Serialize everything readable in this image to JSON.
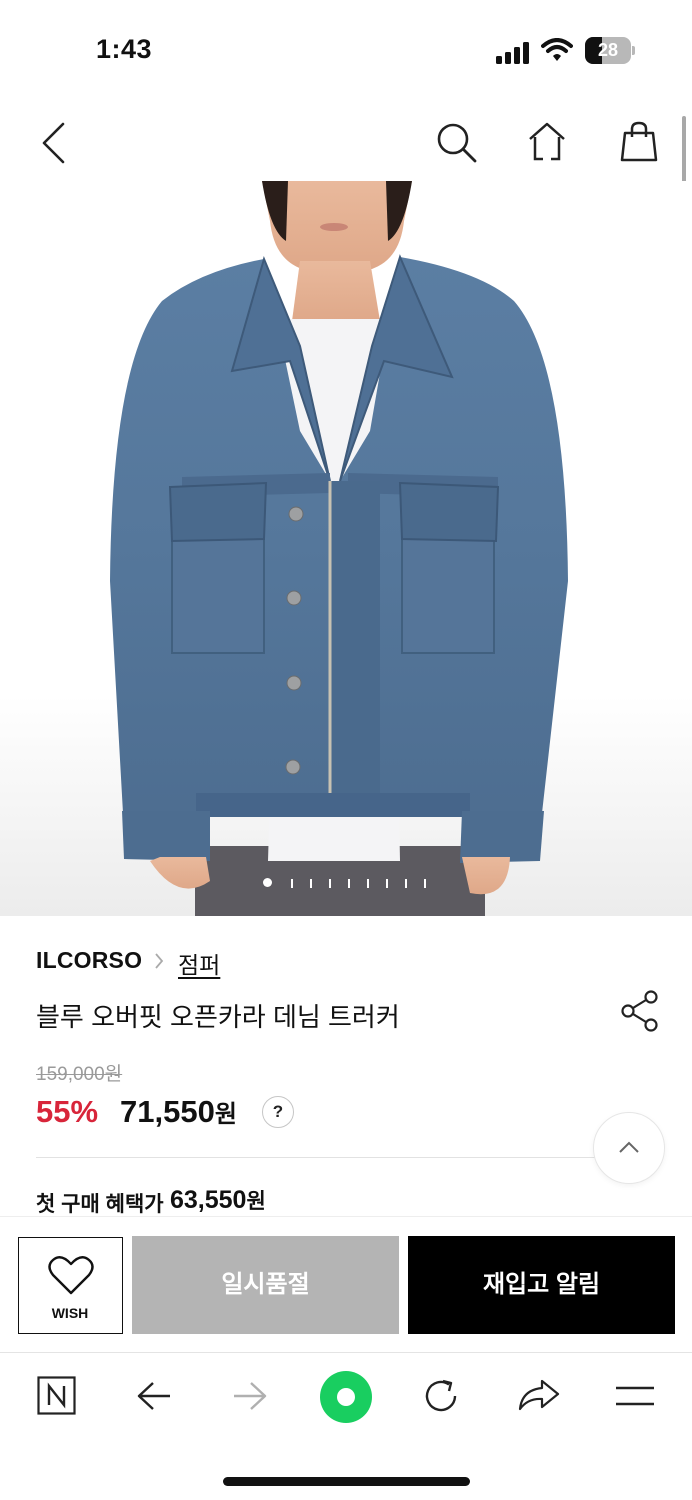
{
  "status_bar": {
    "time": "1:43",
    "battery": "28"
  },
  "header": {
    "back_icon": "chevron-left-icon",
    "search_icon": "search-icon",
    "home_icon": "home-icon",
    "bag_icon": "shopping-bag-icon"
  },
  "gallery": {
    "current_index": 1,
    "total": 9
  },
  "product": {
    "brand": "ILCORSO",
    "category": "점퍼",
    "title": "블루 오버핏 오픈카라 데님 트러커",
    "original_price": "159,000원",
    "discount": "55%",
    "sale_price": "71,550",
    "currency": "원",
    "help": "?",
    "benefit_label": "첫 구매 혜택가",
    "benefit_price": "63,550",
    "benefit_currency": "원"
  },
  "actions": {
    "wish_label": "WISH",
    "soldout_label": "일시품절",
    "restock_label": "재입고 알림"
  },
  "browser_toolbar": {
    "items": [
      "naver-n-icon",
      "back-arrow-icon",
      "forward-arrow-icon",
      "green-circle-icon",
      "refresh-icon",
      "share-arrow-icon",
      "menu-icon"
    ]
  },
  "colors": {
    "discount": "#d8253a",
    "soldout_bg": "#b4b4b4",
    "restock_bg": "#000000",
    "naver_green": "#19ce60"
  }
}
